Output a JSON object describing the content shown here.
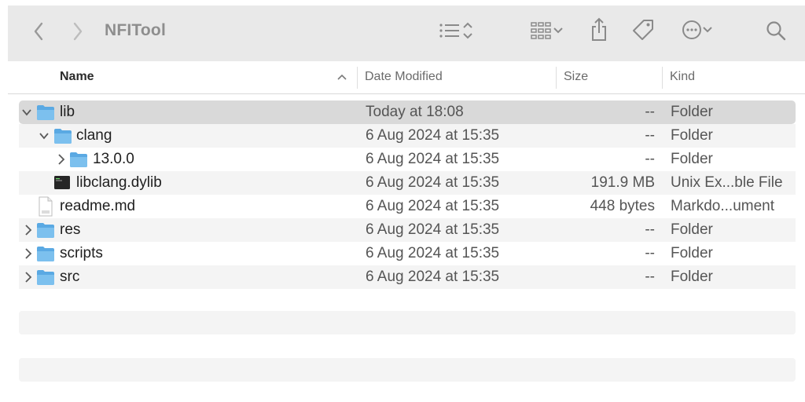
{
  "window": {
    "title": "NFITool",
    "icons": [
      "chevron-left-icon",
      "chevron-right-icon",
      "list-view-icon",
      "sort-updown-icon",
      "grid-view-icon",
      "chevron-down-icon",
      "share-icon",
      "tag-icon",
      "more-icon",
      "chevron-down-icon",
      "search-icon"
    ]
  },
  "columns": {
    "name": "Name",
    "date": "Date Modified",
    "size": "Size",
    "kind": "Kind"
  },
  "rows": [
    {
      "name": "lib",
      "date": "Today at 18:08",
      "size": "--",
      "kind": "Folder",
      "icon": "folder-icon",
      "expanded": true
    },
    {
      "name": "clang",
      "date": "6 Aug 2024 at 15:35",
      "size": "--",
      "kind": "Folder",
      "icon": "folder-icon",
      "expanded": true
    },
    {
      "name": "13.0.0",
      "date": "6 Aug 2024 at 15:35",
      "size": "--",
      "kind": "Folder",
      "icon": "folder-icon",
      "expanded": false
    },
    {
      "name": "libclang.dylib",
      "date": "6 Aug 2024 at 15:35",
      "size": "191.9 MB",
      "kind": "Unix Ex...ble File",
      "icon": "executable-icon"
    },
    {
      "name": "readme.md",
      "date": "6 Aug 2024 at 15:35",
      "size": "448 bytes",
      "kind": "Markdo...ument",
      "icon": "document-icon"
    },
    {
      "name": "res",
      "date": "6 Aug 2024 at 15:35",
      "size": "--",
      "kind": "Folder",
      "icon": "folder-icon",
      "expanded": false
    },
    {
      "name": "scripts",
      "date": "6 Aug 2024 at 15:35",
      "size": "--",
      "kind": "Folder",
      "icon": "folder-icon",
      "expanded": false
    },
    {
      "name": "src",
      "date": "6 Aug 2024 at 15:35",
      "size": "--",
      "kind": "Folder",
      "icon": "folder-icon",
      "expanded": false
    }
  ],
  "colors": {
    "folder": "#67b6ea",
    "selection": "#d9d9d9",
    "stripe": "#f4f4f4"
  }
}
